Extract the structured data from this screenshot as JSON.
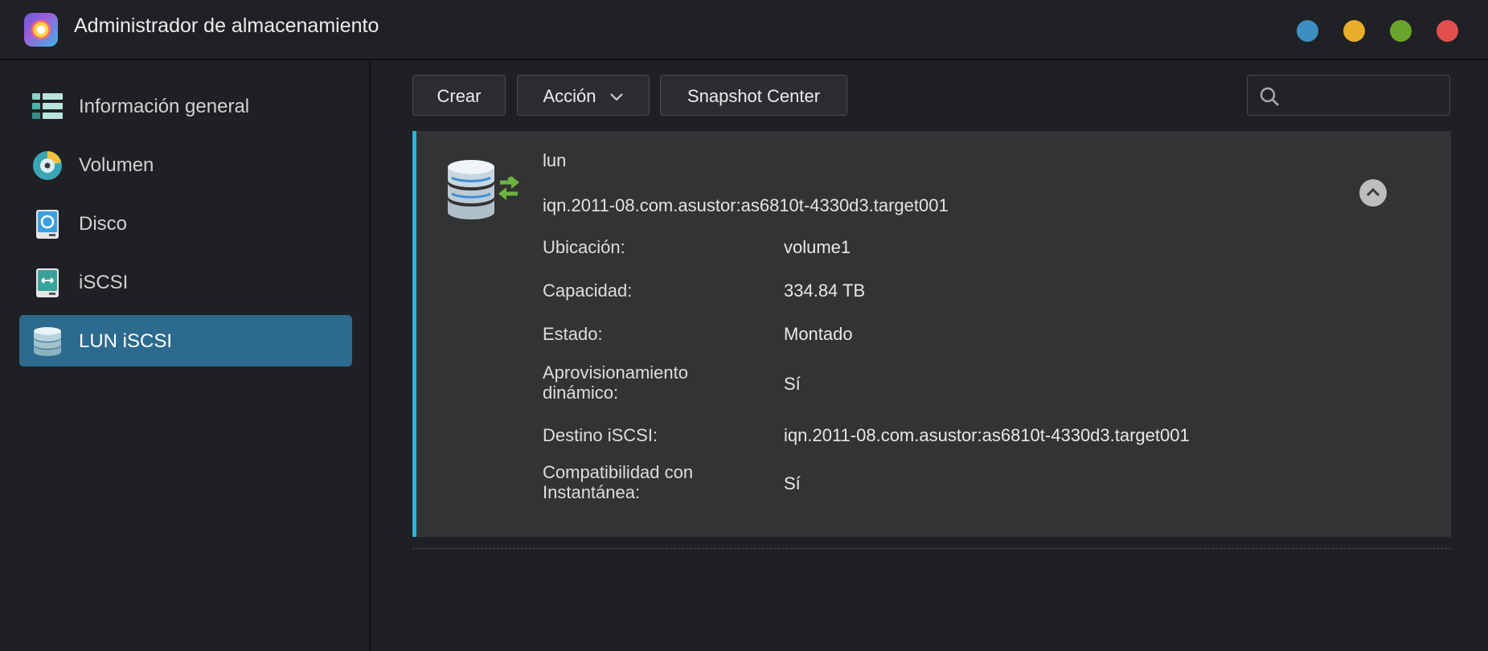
{
  "window": {
    "title": "Administrador de almacenamiento",
    "controls": [
      {
        "name": "minimize",
        "color": "#3d8fc1"
      },
      {
        "name": "maximize",
        "color": "#e7ad2b"
      },
      {
        "name": "restore",
        "color": "#6ba42b"
      },
      {
        "name": "close",
        "color": "#e1504f"
      }
    ]
  },
  "sidebar": {
    "items": [
      {
        "label": "Información general",
        "icon": "overview-icon",
        "active": false
      },
      {
        "label": "Volumen",
        "icon": "volume-icon",
        "active": false
      },
      {
        "label": "Disco",
        "icon": "disk-icon",
        "active": false
      },
      {
        "label": "iSCSI",
        "icon": "iscsi-icon",
        "active": false
      },
      {
        "label": "LUN iSCSI",
        "icon": "lun-icon",
        "active": true
      }
    ]
  },
  "toolbar": {
    "create_label": "Crear",
    "action_label": "Acción",
    "snapshot_label": "Snapshot Center",
    "search_placeholder": ""
  },
  "lun": {
    "name": "lun",
    "target_iqn": "iqn.2011-08.com.asustor:as6810t-4330d3.target001",
    "details": [
      {
        "label": "Ubicación:",
        "value": "volume1"
      },
      {
        "label": "Capacidad:",
        "value": "334.84 TB"
      },
      {
        "label": "Estado:",
        "value": "Montado"
      },
      {
        "label": "Aprovisionamiento dinámico:",
        "value": "Sí"
      },
      {
        "label": "Destino iSCSI:",
        "value": "iqn.2011-08.com.asustor:as6810t-4330d3.target001"
      },
      {
        "label": "Compatibilidad con Instantánea:",
        "value": "Sí"
      }
    ]
  },
  "colors": {
    "accent": "#2ab4d8",
    "active_item": "#2c6a8e",
    "sync_arrows": "#6db33f"
  }
}
